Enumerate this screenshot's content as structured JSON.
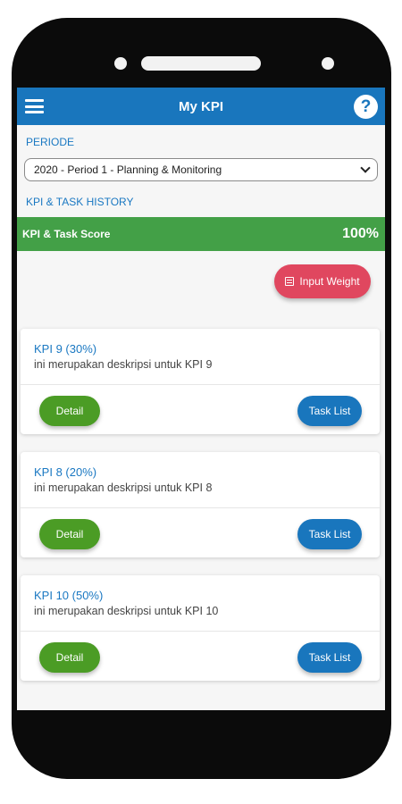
{
  "appbar": {
    "title": "My KPI",
    "menu_icon": "hamburger-menu-icon",
    "help_icon": "help-icon",
    "help_glyph": "?"
  },
  "periode": {
    "label": "PERIODE",
    "selected": "2020 - Period 1 - Planning & Monitoring"
  },
  "history": {
    "label": "KPI & TASK HISTORY"
  },
  "score": {
    "label": "KPI & Task Score",
    "value": "100%"
  },
  "input_weight": {
    "label": "Input Weight",
    "icon": "list-icon"
  },
  "kpis": [
    {
      "title": "KPI 9 (30%)",
      "description": "ini merupakan deskripsi untuk KPI 9",
      "detail_label": "Detail",
      "task_label": "Task List"
    },
    {
      "title": "KPI 8 (20%)",
      "description": "ini merupakan deskripsi untuk KPI 8",
      "detail_label": "Detail",
      "task_label": "Task List"
    },
    {
      "title": "KPI 10 (50%)",
      "description": "ini merupakan deskripsi untuk KPI 10",
      "detail_label": "Detail",
      "task_label": "Task List"
    }
  ],
  "colors": {
    "primary": "#1976bd",
    "score_bar": "#43a047",
    "detail_button": "#4b9c25",
    "input_weight_button": "#e0475f"
  }
}
